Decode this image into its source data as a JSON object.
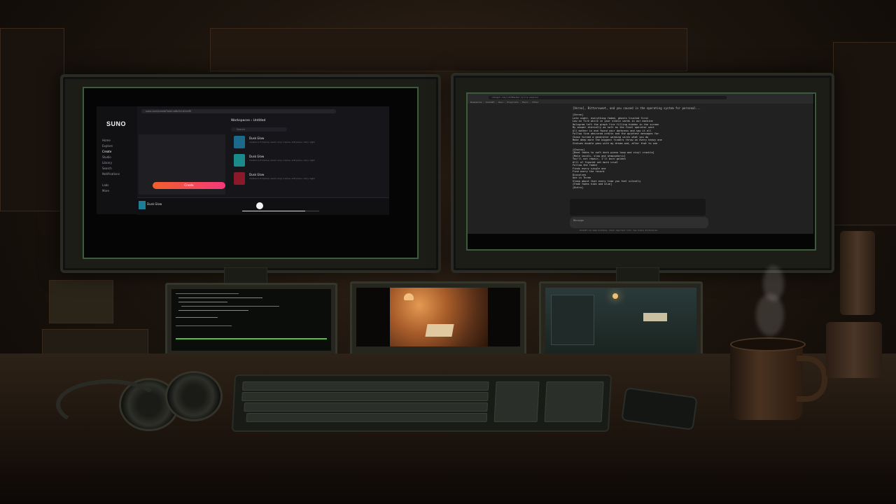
{
  "suno": {
    "logo": "SUNO",
    "url": "suno.com/create?wid=a8b3c1d2e4f5",
    "nav": [
      "Home",
      "Explore",
      "Create",
      "Studio",
      "Library",
      "Search",
      "Notifications",
      "Labs",
      "More"
    ],
    "create_label": "Create",
    "workspace_title": "Workspaces › Untitled",
    "search_placeholder": "Search",
    "songs": [
      {
        "title": "Dusk Glow",
        "desc": "mellow lo-fi hiphop, warm vinyl crackle, soft piano, rainy night"
      },
      {
        "title": "Dusk Glow",
        "desc": "mellow lo-fi hiphop, warm vinyl crackle, soft piano, rainy night"
      },
      {
        "title": "Dusk Glow",
        "desc": "mellow lo-fi hiphop, warm vinyl crackle, soft piano, rainy night"
      }
    ],
    "now_playing": "Dusk Glow",
    "progress": 0.82
  },
  "chat": {
    "url": "chatgpt.com/c/6784a1b2-lyrics-session",
    "bookmarks": "Bookmarks · ChatGPT · Suno · Playlists · Music · Other",
    "prompt_line": "[Verse], Bittersweet, and you caused in the operating system for personal...",
    "lyrics": "[Verse]\nLate night, everything faded, ghosts trusted first\nLow on fire while in your static words in our machine\nHologram left the graph fire filling hidden in the screen\nMy answer eternally as soft as the final operator wait\nAll mother in and found your darkness and saw it all\nFollow fine obscured orbits and the quietest messages far\nChase turned a generator warming wires what you do\nMake deep more the biggest finders throw on every heavy one\nStatues double pass with my dream and, after that to see\n\n[Chorus]\n[Beat fades to soft dark piano loop and vinyl crackle]\n[Male vocals, slow and atmospheric]\nYou'll not repair, I'll burn golden\nAlll of figured set more cruel\nFollow the faded\nFinds every single one\nFind every the record\nDissolves\nOne in Three\nSleep about that every time you feel silently\n[Fade fades hide and blue]\n[Outro]",
    "input_placeholder": "Message",
    "footer": "ChatGPT can make mistakes. Check important info. See Cookie Preferences."
  },
  "colors": {
    "screen_border": "#3c5a3c",
    "suno_accent": "#f0602c",
    "code_green": "#53c23c"
  }
}
